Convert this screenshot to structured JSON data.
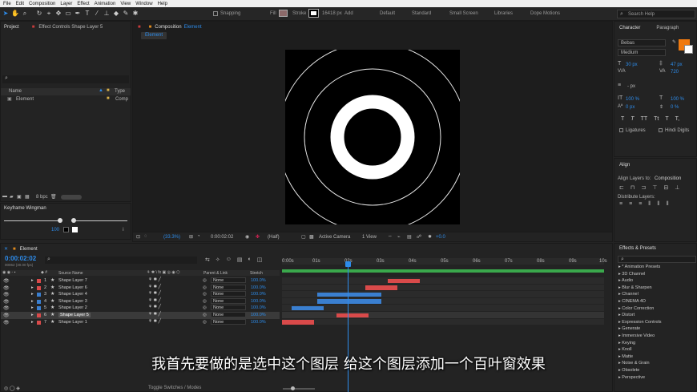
{
  "menu": [
    "File",
    "Edit",
    "Composition",
    "Layer",
    "Effect",
    "Animation",
    "View",
    "Window",
    "Help"
  ],
  "toolbar": {
    "snapping": "Snapping",
    "fill": "Fill",
    "stroke": "Stroke",
    "stroke_px": "16418 px",
    "add": "Add",
    "workspaces": [
      "Default",
      "Standard",
      "Small Screen",
      "Libraries",
      "Dope Motions"
    ],
    "search_placeholder": "Search Help"
  },
  "project_panel": {
    "tab_project": "Project",
    "tab_effect_controls": "Effect Controls Shape Layer 5",
    "col_name": "Name",
    "col_type": "Type",
    "item_name": "Element",
    "item_type": "Comp",
    "bpc": "8 bpc"
  },
  "keyframe_wingman": {
    "title": "Keyframe Wingman",
    "value": "100"
  },
  "composition_panel": {
    "tab": "Composition",
    "tab_name": "Element",
    "breadcrumb": "Element",
    "zoom": "(33.3%)",
    "timecode": "0:00:02:02",
    "resolution": "(Half)",
    "camera": "Active Camera",
    "views": "1 View",
    "exposure": "+0.0"
  },
  "character_panel": {
    "tab_character": "Character",
    "tab_paragraph": "Paragraph",
    "font": "Bebas",
    "style": "Medium",
    "font_size": "30 px",
    "leading": "47 px",
    "tracking": "720",
    "kerning": "0",
    "stroke_width": "- px",
    "vscale": "100 %",
    "hscale": "100 %",
    "baseline": "0 px",
    "tsume": "0 %",
    "ligatures": "Ligatures",
    "hindi_digits": "Hindi Digits",
    "style_buttons": [
      "T",
      "T",
      "TT",
      "Tt",
      "T",
      "T,"
    ]
  },
  "align_panel": {
    "title": "Align",
    "align_to_label": "Align Layers to:",
    "align_to_value": "Composition",
    "distribute": "Distribute Layers:"
  },
  "effects_presets": {
    "title": "Effects & Presets",
    "items": [
      "* Animation Presets",
      "3D Channel",
      "Audio",
      "Blur & Sharpen",
      "Channel",
      "CINEMA 4D",
      "Color Correction",
      "Distort",
      "Expression Controls",
      "Generate",
      "Immersive Video",
      "Keying",
      "Knoll",
      "Matte",
      "Noise & Grain",
      "Obsolete",
      "Perspective"
    ]
  },
  "timeline": {
    "tab": "Element",
    "timecode": "0:00:02:02",
    "fps": "00062 (30.00 fps)",
    "col_source": "Source Name",
    "col_parent": "Parent & Link",
    "col_stretch": "Stretch",
    "ruler": [
      "0:00s",
      "01s",
      "02s",
      "03s",
      "04s",
      "05s",
      "06s",
      "07s",
      "08s",
      "09s",
      "10s"
    ],
    "toggle_label": "Toggle Switches / Modes",
    "layers": [
      {
        "num": "1",
        "name": "Shape Layer 7",
        "color": "#d94a4a",
        "parent": "None",
        "stretch": "100.0%"
      },
      {
        "num": "2",
        "name": "Shape Layer 6",
        "color": "#d94a4a",
        "parent": "None",
        "stretch": "100.0%"
      },
      {
        "num": "3",
        "name": "Shape Layer 4",
        "color": "#3a7fd0",
        "parent": "None",
        "stretch": "100.0%"
      },
      {
        "num": "4",
        "name": "Shape Layer 3",
        "color": "#3a7fd0",
        "parent": "None",
        "stretch": "100.0%"
      },
      {
        "num": "5",
        "name": "Shape Layer 2",
        "color": "#3a7fd0",
        "parent": "None",
        "stretch": "100.0%"
      },
      {
        "num": "6",
        "name": "Shape Layer 5",
        "color": "#d94a4a",
        "parent": "None",
        "stretch": "100.0%"
      },
      {
        "num": "7",
        "name": "Shape Layer 1",
        "color": "#d94a4a",
        "parent": "None",
        "stretch": "100.0%"
      }
    ]
  },
  "subtitle": "我首先要做的是选中这个图层 给这个图层添加一个百叶窗效果"
}
